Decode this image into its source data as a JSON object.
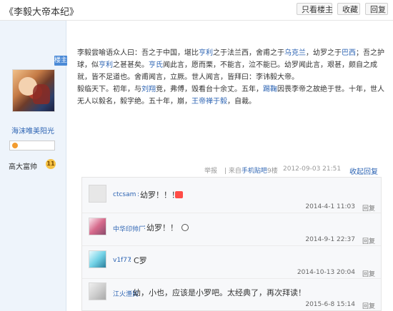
{
  "header": {
    "title": "《李毅大帝本纪》",
    "buttons": {
      "only_op": "只看楼主",
      "favorite": "收藏",
      "reply": "回复"
    }
  },
  "user": {
    "badge": "楼主",
    "name": "海沫唯美阳光",
    "level_text": "高大富帅",
    "level_num": "11"
  },
  "post": {
    "p1": {
      "a": "李毅尝喻语众人曰：吾之于中国，堪比",
      "b": "亨利",
      "c": "之于法兰西，舍甫之于",
      "d": "乌克兰",
      "e": "，幼罗之于",
      "f": "巴西",
      "g": "；吾之护球，似",
      "h": "亨利",
      "i": "之甚甚矣。",
      "j": "亨氏",
      "k": "闻此言，愿而栗，不能言，泣不能已。幼罗闻此言，艰甚，颇自之成就，皆不足道也。舍甫闻言，立厥。世人闻言，皆拜曰：李讳毅大帝。"
    },
    "p2": {
      "a": "毅临天下。初年，与",
      "b": "刘翔",
      "c": "竞，弗傅，毁看台十余丈。五年，",
      "d": "踢鞠",
      "e": "因畏李帝之故绝于世。十年，世人无人以毅名，毅字绝。五十年，崩，",
      "f": "王帝",
      "g": "禅于毅",
      "h": "，自裁。"
    }
  },
  "tail": {
    "report": "举报",
    "from_prefix": "| 来自",
    "client": "手机贴吧",
    "floor": "9楼",
    "time": "2012-09-03 21:51",
    "collapse": "收起回复"
  },
  "replies": [
    {
      "user": "ctcsam",
      "colon": ":",
      "text": "幼罗！！！",
      "time": "2014-4-1 11:03",
      "action": "回复"
    },
    {
      "user": "中华印帅厂",
      "colon": ":",
      "text": "幼罗！！",
      "time": "2014-9-1 22:37",
      "action": "回复"
    },
    {
      "user": "v1f77",
      "colon": ":",
      "text": "C罗",
      "time": "2014-10-13 20:04",
      "action": "回复"
    },
    {
      "user": "江火渔民",
      "colon": ":",
      "text": "幼，小也，应该是小罗吧。太经典了，再次拜读！",
      "time": "2015-6-8 15:14",
      "action": "回复"
    }
  ]
}
